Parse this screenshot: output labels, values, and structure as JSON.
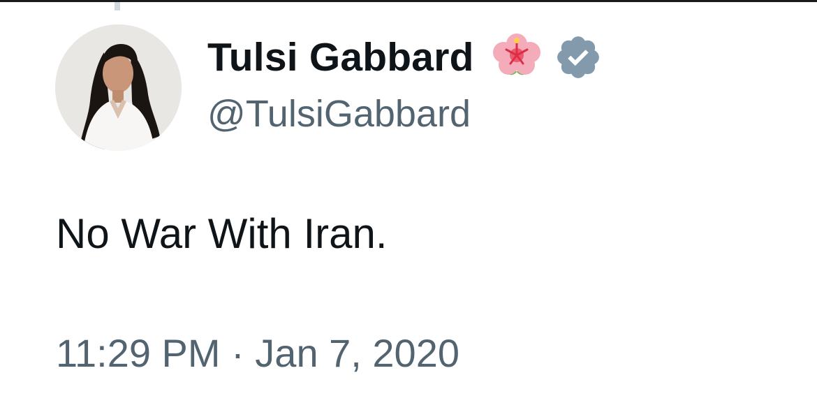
{
  "tweet": {
    "author": {
      "display_name": "Tulsi Gabbard",
      "handle": "@TulsiGabbard",
      "badge_emoji_icon": "hibiscus-icon",
      "verified_icon": "verified-badge-icon"
    },
    "text": "No War With Iran.",
    "timestamp": "11:29 PM · Jan 7, 2020"
  },
  "colors": {
    "text_primary": "#0f1419",
    "text_secondary": "#536471",
    "verified_badge": "#829aab",
    "background": "#ffffff"
  }
}
